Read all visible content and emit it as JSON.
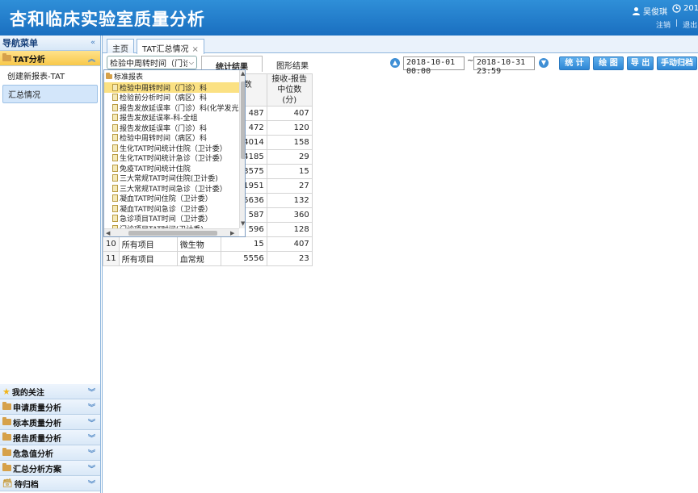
{
  "header": {
    "title": "杏和临床实验室质量分析",
    "user": "吴俊琪",
    "clock_text": "201",
    "logout": "注销",
    "exit": "退出",
    "separator": "|"
  },
  "sidebar": {
    "nav_title": "导航菜单",
    "collapse_glyph": "«",
    "active_section": "TAT分析",
    "sub_items": [
      "创建新报表-TAT",
      "汇总情况"
    ],
    "bottom_sections": [
      "我的关注",
      "申请质量分析",
      "标本质量分析",
      "报告质量分析",
      "危急值分析",
      "汇总分析方案",
      "待归档"
    ]
  },
  "tabs": {
    "home": "主页",
    "summary": "TAT汇总情况",
    "close": "×"
  },
  "toolbar": {
    "select_value": "检验中周转时间（门诊）科",
    "subtab_stats": "统计结果",
    "subtab_graph": "图形结果",
    "date_from": "2018-10-01 00:00",
    "date_to": "2018-10-31 23:59",
    "tilde": "~",
    "btn_stats": "统 计",
    "btn_plot": "绘 图",
    "btn_export": "导 出",
    "btn_archive": "手动归档"
  },
  "table": {
    "header_count_line1": "本数",
    "header_count_line2": ")",
    "header_median_line1": "接收-报告",
    "header_median_line2": "中位数",
    "header_median_line3": "(分)",
    "rows": [
      {
        "idx": "",
        "project": "",
        "group": "",
        "count": "487",
        "median": "407"
      },
      {
        "idx": "",
        "project": "",
        "group": "",
        "count": "472",
        "median": "120"
      },
      {
        "idx": "",
        "project": "",
        "group": "",
        "count": "4014",
        "median": "158"
      },
      {
        "idx": "",
        "project": "",
        "group": "",
        "count": "4185",
        "median": "29"
      },
      {
        "idx": "",
        "project": "",
        "group": "",
        "count": "3575",
        "median": "15"
      },
      {
        "idx": "",
        "project": "",
        "group": "",
        "count": "1951",
        "median": "27"
      },
      {
        "idx": "",
        "project": "",
        "group": "",
        "count": "5636",
        "median": "132"
      },
      {
        "idx": "",
        "project": "",
        "group": "",
        "count": "587",
        "median": "360"
      },
      {
        "idx": "",
        "project": "",
        "group": "",
        "count": "596",
        "median": "128"
      },
      {
        "idx": "10",
        "project": "所有项目",
        "group": "微生物",
        "count": "15",
        "median": "407"
      },
      {
        "idx": "11",
        "project": "所有项目",
        "group": "血常规",
        "count": "5556",
        "median": "23"
      }
    ]
  },
  "dropdown": {
    "root": "标准报表",
    "items": [
      "检验中周转时间（门诊）科",
      "检验前分析时间（病区）科",
      "报告发放延误率（门诊）科(化学发光)",
      "报告发放延误率-科-全组",
      "报告发放延误率（门诊）科",
      "检验中周转时间（病区）科",
      "生化TAT时间统计住院（卫计委）",
      "生化TAT时间统计急诊（卫计委）",
      "免疫TAT时间统计住院",
      "三大常规TAT时间住院(卫计委)",
      "三大常规TAT时间急诊（卫计委）",
      "凝血TAT时间住院（卫计委）",
      "凝血TAT时间急诊（卫计委）",
      "急诊项目TAT时间（卫计委）",
      "门诊项目TAT时间(卫计委)"
    ],
    "highlighted_index": 0
  }
}
